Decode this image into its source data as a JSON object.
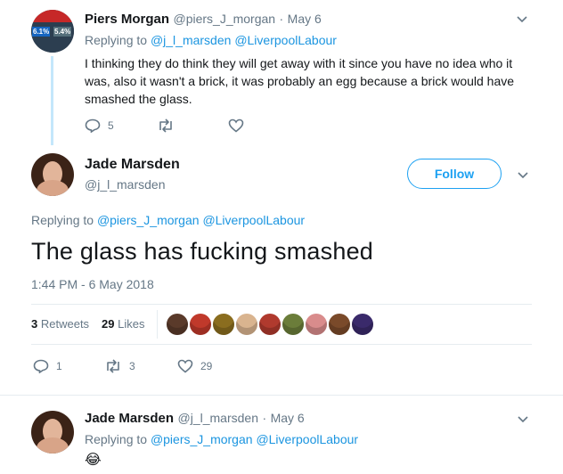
{
  "tweet1": {
    "name": "Piers Morgan",
    "handle": "@piers_J_morgan",
    "sep": "·",
    "date": "May 6",
    "avatar_text_left": "6.1%",
    "avatar_text_right": "5.4%",
    "replying_prefix": "Replying to",
    "replying_to_1": "@j_l_marsden",
    "replying_to_2": "@LiverpoolLabour",
    "text": "I thinking they do think they will get away with it since you have no idea who it was, also it wasn't a brick, it was probably an egg because a brick would have smashed the glass.",
    "replies": "5"
  },
  "tweet2": {
    "name": "Jade Marsden",
    "handle": "@j_l_marsden",
    "follow_label": "Follow",
    "replying_prefix": "Replying to",
    "replying_to_1": "@piers_J_morgan",
    "replying_to_2": "@LiverpoolLabour",
    "text": "The glass has fucking smashed",
    "timestamp": "1:44 PM - 6 May 2018",
    "retweets_count": "3",
    "retweets_label": "Retweets",
    "likes_count": "29",
    "likes_label": "Likes",
    "liker_colors": [
      "#5a3a2a",
      "#c0392b",
      "#8a6d1f",
      "#d9b48f",
      "#b03a2e",
      "#6b7d3a",
      "#d98c8c",
      "#7a4a2a",
      "#3a2a6b"
    ],
    "actions": {
      "replies": "1",
      "retweets": "3",
      "likes": "29"
    }
  },
  "tweet3": {
    "name": "Jade Marsden",
    "handle": "@j_l_marsden",
    "sep": "·",
    "date": "May 6",
    "replying_prefix": "Replying to",
    "replying_to_1": "@piers_J_morgan",
    "replying_to_2": "@LiverpoolLabour",
    "text": "😂"
  }
}
